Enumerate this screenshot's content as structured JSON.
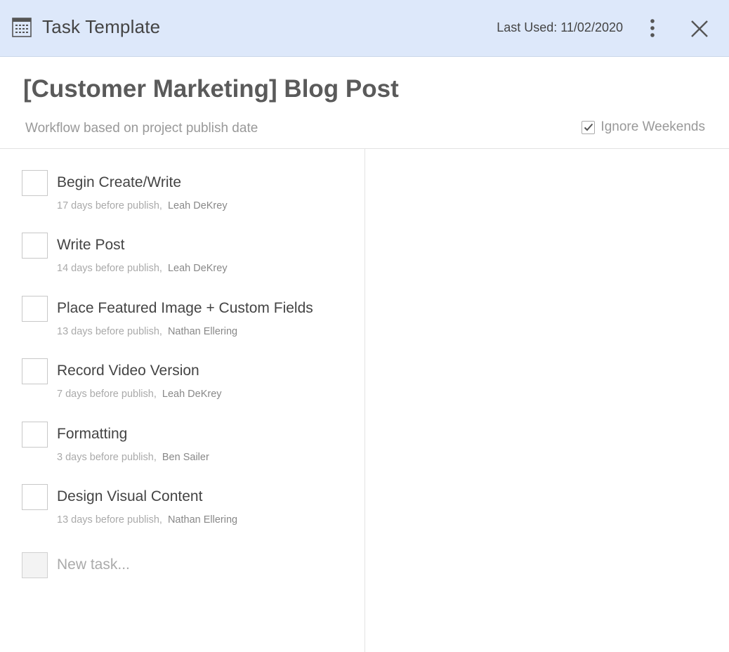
{
  "header": {
    "title": "Task Template",
    "last_used": "Last Used: 11/02/2020",
    "icon": "template-calendar-icon",
    "more_icon": "more-vertical-icon",
    "close_icon": "close-icon",
    "background": "#dde8fa"
  },
  "template": {
    "title": "[Customer Marketing] Blog Post",
    "subtitle": "Workflow based on project publish date",
    "ignore_weekends_label": "Ignore Weekends",
    "ignore_weekends_checked": true
  },
  "tasks": [
    {
      "name": "Begin Create/Write",
      "when": "17 days before publish,",
      "assignee": "Leah DeKrey"
    },
    {
      "name": "Write Post",
      "when": "14 days before publish,",
      "assignee": "Leah DeKrey"
    },
    {
      "name": "Place Featured Image + Custom Fields",
      "when": "13 days before publish,",
      "assignee": "Nathan Ellering"
    },
    {
      "name": "Record Video Version",
      "when": "7 days before publish,",
      "assignee": "Leah DeKrey"
    },
    {
      "name": "Formatting",
      "when": "3 days before publish,",
      "assignee": "Ben Sailer"
    },
    {
      "name": "Design Visual Content",
      "when": "13 days before publish,",
      "assignee": "Nathan Ellering"
    }
  ],
  "new_task": {
    "placeholder": "New task..."
  }
}
